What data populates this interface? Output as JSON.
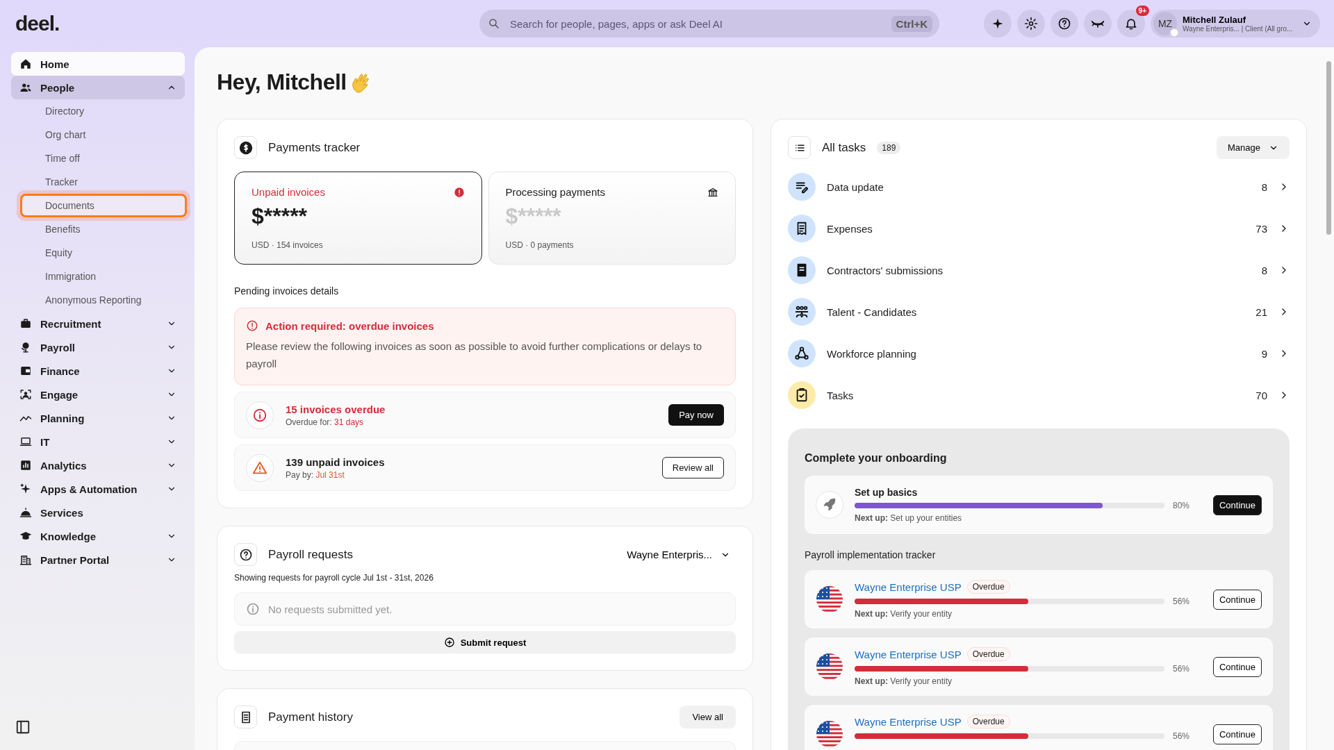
{
  "topbar": {
    "logo": "deel.",
    "search": {
      "placeholder": "Search for people, pages, apps or ask Deel AI",
      "shortcut": "Ctrl+K"
    },
    "notifications_badge": "9+",
    "user": {
      "initials": "MZ",
      "name": "Mitchell Zulauf",
      "subtitle": "Wayne Enterpris... | Client (All gro..."
    }
  },
  "sidebar": {
    "items": [
      {
        "label": "Home",
        "kind": "link",
        "selected": true
      },
      {
        "label": "People",
        "kind": "group",
        "selected": false,
        "expanded": true,
        "children": [
          {
            "label": "Directory",
            "highlighted": false
          },
          {
            "label": "Org chart",
            "highlighted": false
          },
          {
            "label": "Time off",
            "highlighted": false
          },
          {
            "label": "Tracker",
            "highlighted": false
          },
          {
            "label": "Documents",
            "highlighted": true
          },
          {
            "label": "Benefits",
            "highlighted": false
          },
          {
            "label": "Equity",
            "highlighted": false
          },
          {
            "label": "Immigration",
            "highlighted": false
          },
          {
            "label": "Anonymous Reporting",
            "highlighted": false
          }
        ]
      },
      {
        "label": "Recruitment",
        "kind": "group",
        "selected": false,
        "expanded": false
      },
      {
        "label": "Payroll",
        "kind": "group",
        "selected": false,
        "expanded": false
      },
      {
        "label": "Finance",
        "kind": "group",
        "selected": false,
        "expanded": false
      },
      {
        "label": "Engage",
        "kind": "group",
        "selected": false,
        "expanded": false
      },
      {
        "label": "Planning",
        "kind": "group",
        "selected": false,
        "expanded": false
      },
      {
        "label": "IT",
        "kind": "group",
        "selected": false,
        "expanded": false
      },
      {
        "label": "Analytics",
        "kind": "group",
        "selected": false,
        "expanded": false
      },
      {
        "label": "Apps & Automation",
        "kind": "group",
        "selected": false,
        "expanded": false
      },
      {
        "label": "Services",
        "kind": "link",
        "selected": false
      },
      {
        "label": "Knowledge",
        "kind": "group",
        "selected": false,
        "expanded": false
      },
      {
        "label": "Partner Portal",
        "kind": "group",
        "selected": false,
        "expanded": false
      }
    ]
  },
  "greeting": "Hey, Mitchell",
  "payments_tracker": {
    "title": "Payments tracker",
    "cards": [
      {
        "kind": "alert",
        "label": "Unpaid invoices",
        "amount": "$*****",
        "caption": "USD · 154 invoices",
        "selected": true
      },
      {
        "kind": "bank",
        "label": "Processing payments",
        "amount": "$*****",
        "caption": "USD · 0 payments",
        "selected": false
      }
    ],
    "pending_title": "Pending invoices details",
    "alert": {
      "title": "Action required: overdue invoices",
      "message": "Please review the following invoices as soon as possible to avoid further complications or delays to payroll"
    },
    "rows": [
      {
        "kind": "overdue",
        "title": "15 invoices overdue",
        "detail_label": "Overdue for:",
        "detail_value": "31 days",
        "button": "Pay now"
      },
      {
        "kind": "unpaid",
        "title": "139 unpaid invoices",
        "detail_label": "Pay by:",
        "detail_value": "Jul 31st",
        "button": "Review all"
      }
    ]
  },
  "payroll_requests": {
    "title": "Payroll requests",
    "entity": "Wayne Enterpris...",
    "subtitle": "Showing requests for payroll cycle Jul 1st - 31st, 2026",
    "empty": "No requests submitted yet.",
    "button": "Submit request"
  },
  "payment_history": {
    "title": "Payment history",
    "button": "View all"
  },
  "tasks": {
    "title": "All tasks",
    "count": "189",
    "button": "Manage",
    "items": [
      {
        "label": "Data update",
        "count": "8",
        "color": "#cfe4fc"
      },
      {
        "label": "Expenses",
        "count": "73",
        "color": "#cfe4fc"
      },
      {
        "label": "Contractors' submissions",
        "count": "8",
        "color": "#cfe4fc"
      },
      {
        "label": "Talent - Candidates",
        "count": "21",
        "color": "#cfe4fc"
      },
      {
        "label": "Workforce planning",
        "count": "9",
        "color": "#cfe4fc"
      },
      {
        "label": "Tasks",
        "count": "70",
        "color": "#fdeba8"
      }
    ]
  },
  "onboarding": {
    "title": "Complete your onboarding",
    "setup": {
      "title": "Set up basics",
      "level": 0.8,
      "percent": "80%",
      "next_up": "**Next up:** Set up your entities",
      "button": "Continue"
    },
    "tracker_title": "Payroll implementation tracker",
    "trackers": [
      {
        "name": "Wayne Enterprise USP",
        "badge": "Overdue",
        "level": 0.56,
        "percent": "56%",
        "next_up": "**Next up:** Verify your entity",
        "button": "Continue"
      },
      {
        "name": "Wayne Enterprise USP",
        "badge": "Overdue",
        "level": 0.56,
        "percent": "56%",
        "next_up": "**Next up:** Verify your entity",
        "button": "Continue"
      },
      {
        "name": "Wayne Enterprise USP",
        "badge": "Overdue",
        "level": 0.56,
        "percent": "56%",
        "button": "Continue"
      }
    ]
  }
}
